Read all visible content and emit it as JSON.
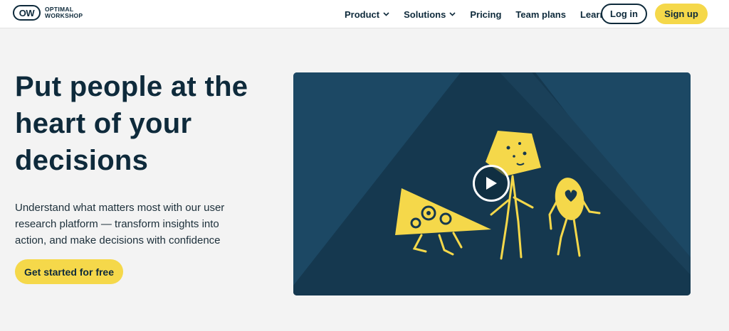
{
  "brand": {
    "mark": "OW",
    "line1": "OPTIMAL",
    "line2": "WORKSHOP"
  },
  "nav": {
    "items": [
      {
        "label": "Product",
        "has_dropdown": true
      },
      {
        "label": "Solutions",
        "has_dropdown": true
      },
      {
        "label": "Pricing",
        "has_dropdown": false
      },
      {
        "label": "Team plans",
        "has_dropdown": false
      },
      {
        "label": "Learn",
        "has_dropdown": true
      }
    ],
    "login_label": "Log in",
    "signup_label": "Sign up"
  },
  "hero": {
    "title": "Put people at the heart of your decisions",
    "subtitle": "Understand what matters most with our user research platform — transform insights into action, and make decisions with confidence",
    "cta_label": "Get started for free"
  },
  "video": {
    "icons": [
      "play-icon",
      "gear-triangle-character",
      "square-head-character",
      "egg-heart-character"
    ]
  },
  "colors": {
    "accent_yellow": "#f5d84a",
    "navy": "#0e2a3b",
    "video_bg": "#1c4864",
    "video_dark": "#15384f"
  }
}
